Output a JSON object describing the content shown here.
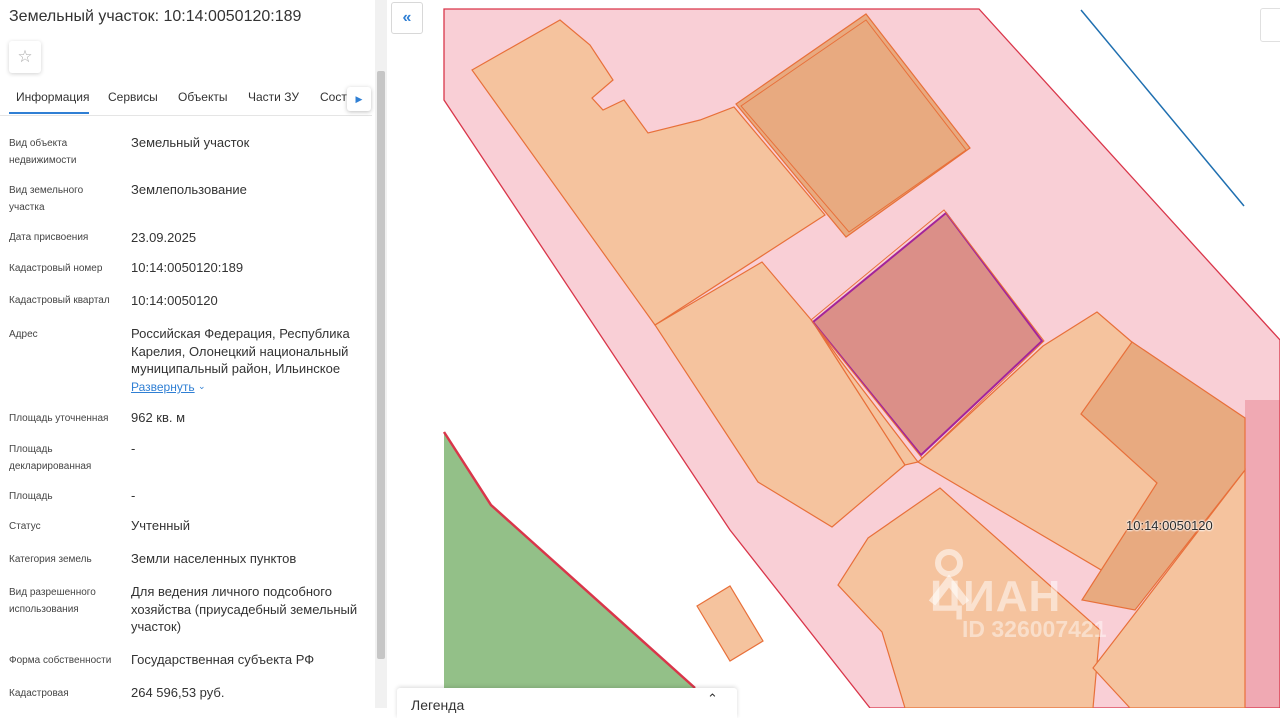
{
  "panel": {
    "title": "Земельный участок: 10:14:0050120:189",
    "tabs": [
      {
        "label": "Информация"
      },
      {
        "label": "Сервисы"
      },
      {
        "label": "Объекты"
      },
      {
        "label": "Части ЗУ"
      },
      {
        "label": "Соста"
      }
    ],
    "active_tab": "Информация",
    "rows": [
      {
        "label": "Вид объекта недвижимости",
        "value": "Земельный участок"
      },
      {
        "label": "Вид земельного участка",
        "value": "Землепользование"
      },
      {
        "label": "Дата присвоения",
        "value": "23.09.2025"
      },
      {
        "label": "Кадастровый номер",
        "value": "10:14:0050120:189"
      },
      {
        "label": "Кадастровый квартал",
        "value": "10:14:0050120"
      },
      {
        "label": "Адрес",
        "value": "Российская Федерация, Республика Карелия, Олонецкий национальный муниципальный район, Ильинское"
      },
      {
        "label": "Площадь уточненная",
        "value": "962 кв. м"
      },
      {
        "label": "Площадь декларированная",
        "value": "-"
      },
      {
        "label": "Площадь",
        "value": "-"
      },
      {
        "label": "Статус",
        "value": "Учтенный"
      },
      {
        "label": "Категория земель",
        "value": "Земли населенных пунктов"
      },
      {
        "label": "Вид разрешенного использования",
        "value": "Для ведения личного подсобного хозяйства (приусадебный земельный участок)"
      },
      {
        "label": "Форма собственности",
        "value": "Государственная субъекта РФ"
      },
      {
        "label": "Кадастровая",
        "value": "264 596,53 руб."
      }
    ],
    "expand_label": "Развернуть"
  },
  "map": {
    "quarter_label": "10:14:0050120",
    "watermark": "ЦИАН",
    "watermark_id": "ID 326007421",
    "legend_label": "Легенда",
    "colors": {
      "quarter_fill": "#f9cfd6",
      "quarter_border": "#d9364a",
      "parcel_fill": "#f5c39e",
      "parcel_border": "#e8703a",
      "building_fill": "#e8aa80",
      "selected_fill": "#db8f88",
      "selected_border": "#a3249a",
      "green_fill": "#93c088",
      "line_blue": "#1f6fb0"
    }
  },
  "icons": {
    "star": "star-icon",
    "tabs_next": "chevron-right-icon",
    "expand": "chevron-down-icon",
    "collapse": "double-chevron-left-icon",
    "legend": "chevron-up-icon"
  }
}
